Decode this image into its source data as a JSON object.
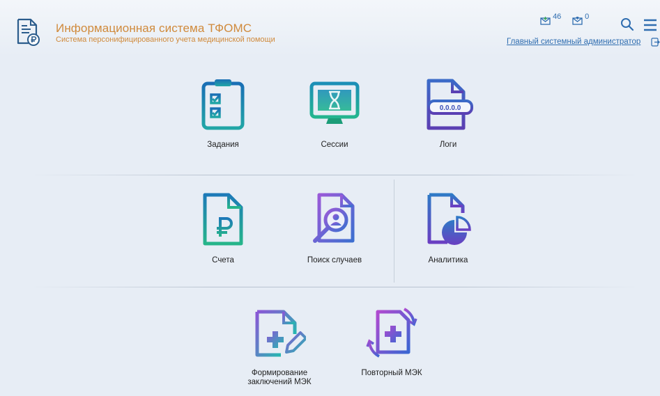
{
  "header": {
    "title": "Информационная система ТФОМС",
    "subtitle": "Система персонифицированного учета медицинской помощи",
    "inbox_count": "46",
    "outbox_count": "0",
    "user": "Главный системный администратор"
  },
  "tiles": {
    "tasks": "Задания",
    "sessions": "Сессии",
    "logs": "Логи",
    "logs_badge": "0.0.0.0",
    "invoices": "Счета",
    "case_search": "Поиск случаев",
    "analytics": "Аналитика",
    "mek_reports": "Формирование заключений МЭК",
    "repeat_mek": "Повторный МЭК"
  },
  "colors": {
    "brand_orange": "#d08a3c",
    "link_blue": "#2f6db0",
    "teal": "#1d9ca6",
    "purple": "#7b4fd0"
  }
}
